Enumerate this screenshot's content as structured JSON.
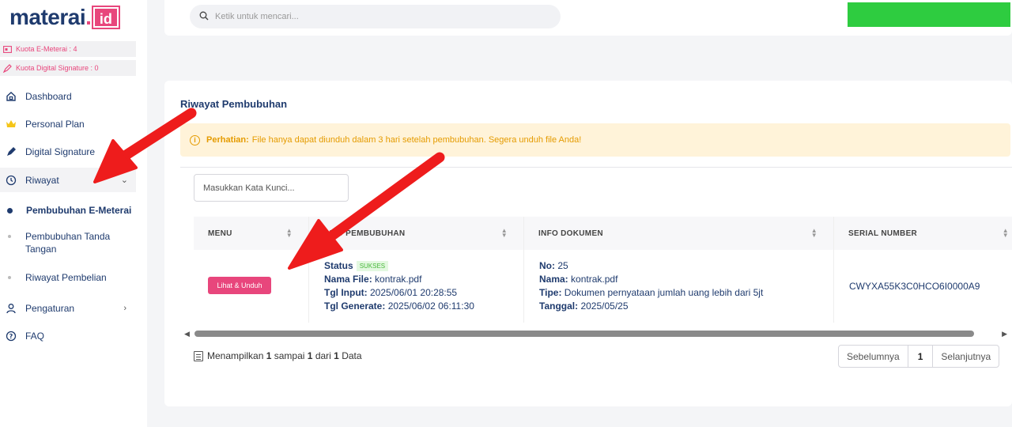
{
  "brand": {
    "name": "materai",
    "dot": ".",
    "suffix": "id"
  },
  "quota": {
    "emeterai": "Kuota E-Meterai : 4",
    "digital_signature": "Kuota Digital Signature : 0"
  },
  "sidebar": {
    "items": [
      {
        "label": "Dashboard",
        "icon": "home-icon"
      },
      {
        "label": "Personal Plan",
        "icon": "crown-icon"
      },
      {
        "label": "Digital Signature",
        "icon": "pen-icon"
      },
      {
        "label": "Riwayat",
        "icon": "history-icon"
      },
      {
        "label": "Pengaturan",
        "icon": "user-icon"
      },
      {
        "label": "FAQ",
        "icon": "help-icon"
      }
    ],
    "riwayat_sub": [
      {
        "label": "Pembubuhan E-Meterai"
      },
      {
        "label": "Pembubuhan Tanda Tangan"
      },
      {
        "label": "Riwayat Pembelian"
      }
    ]
  },
  "search": {
    "placeholder": "Ketik untuk mencari..."
  },
  "colors": {
    "brand_navy": "#1f3b6e",
    "accent_pink": "#e8467c",
    "green": "#2ecc40",
    "warning": "#e59b00"
  },
  "main": {
    "title": "Riwayat Pembubuhan",
    "alert": {
      "strong": "Perhatian:",
      "text": "File hanya dapat diunduh dalam 3 hari setelah pembubuhan. Segera unduh file Anda!"
    },
    "keyword_placeholder": "Masukkan Kata Kunci...",
    "columns": [
      "MENU",
      "INFO PEMBUBUHAN",
      "INFO DOKUMEN",
      "SERIAL NUMBER"
    ],
    "rows": [
      {
        "action_label": "Lihat & Unduh",
        "status_label": "Status",
        "status_value": "SUKSES",
        "file_label": "Nama File:",
        "file_value": "kontrak.pdf",
        "input_label": "Tgl Input:",
        "input_value": "2025/06/01 20:28:55",
        "generate_label": "Tgl Generate:",
        "generate_value": "2025/06/02 06:11:30",
        "no_label": "No:",
        "no_value": "25",
        "nama_label": "Nama:",
        "nama_value": "kontrak.pdf",
        "tipe_label": "Tipe:",
        "tipe_value": "Dokumen pernyataan jumlah uang lebih dari 5jt",
        "tanggal_label": "Tanggal:",
        "tanggal_value": "2025/05/25",
        "serial": "CWYXA55K3C0HCO6I0000A9"
      }
    ],
    "footer": {
      "prefix": "Menampilkan",
      "from": "1",
      "mid1": "sampai",
      "to": "1",
      "mid2": "dari",
      "total": "1",
      "suffix": "Data"
    },
    "pagination": {
      "prev": "Sebelumnya",
      "current": "1",
      "next": "Selanjutnya"
    }
  }
}
